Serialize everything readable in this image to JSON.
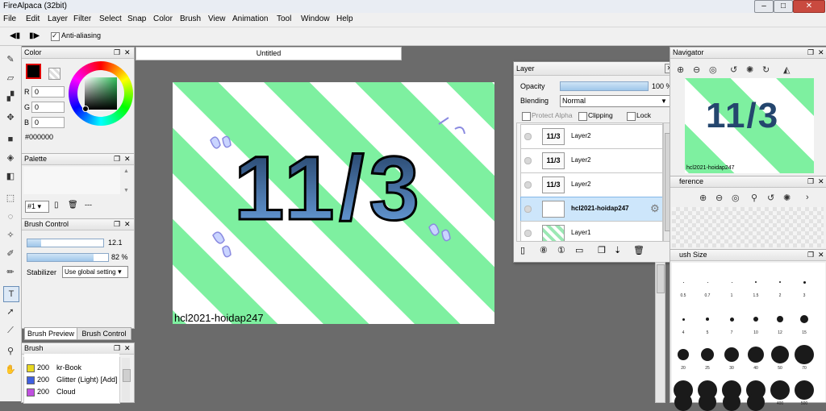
{
  "window": {
    "title": "FireAlpaca (32bit)"
  },
  "menu": [
    "File",
    "Edit",
    "Layer",
    "Filter",
    "Select",
    "Snap",
    "Color",
    "Brush",
    "View",
    "Animation",
    "Tool",
    "Window",
    "Help"
  ],
  "options": {
    "anti_aliasing": "Anti-aliasing"
  },
  "color_panel": {
    "title": "Color",
    "r_label": "R",
    "r": "0",
    "g_label": "G",
    "g": "0",
    "b_label": "B",
    "b": "0",
    "hex": "#000000"
  },
  "palette_panel": {
    "title": "Palette",
    "set": "#1",
    "more": "---"
  },
  "brush_control": {
    "title": "Brush Control",
    "size": "12.1",
    "size_fraction": 0.18,
    "opacity": "82 %",
    "opacity_fraction": 0.82,
    "stabilizer_label": "Stabilizer",
    "stabilizer_value": "Use global setting"
  },
  "tabs": {
    "preview": "Brush Preview",
    "control": "Brush Control"
  },
  "brush_panel": {
    "title": "Brush",
    "items": [
      {
        "size": "200",
        "name": "kr-Book",
        "color": "#e8d820"
      },
      {
        "size": "200",
        "name": "Glitter (Light) [Add]",
        "color": "#4060e0"
      },
      {
        "size": "200",
        "name": "Cloud",
        "color": "#c050e0"
      }
    ]
  },
  "document": {
    "tab": "Untitled",
    "watermark": "hcl2021-hoidap247",
    "drawing_text": "11/3"
  },
  "layer_panel": {
    "title": "Layer",
    "opacity_label": "Opacity",
    "opacity": "100 %",
    "opacity_fraction": 1.0,
    "blending_label": "Blending",
    "blending": "Normal",
    "protect_alpha": "Protect Alpha",
    "clipping": "Clipping",
    "lock": "Lock",
    "layers": [
      {
        "name": "Layer2",
        "thumb": "11/3",
        "selected": false
      },
      {
        "name": "Layer2",
        "thumb": "11/3",
        "selected": false
      },
      {
        "name": "Layer2",
        "thumb": "11/3",
        "selected": false
      },
      {
        "name": "hcl2021-hoidap247",
        "thumb": "",
        "selected": true
      },
      {
        "name": "Layer1",
        "thumb": "",
        "selected": false
      }
    ]
  },
  "navigator": {
    "title": "Navigator",
    "thumb_text": "11/3",
    "thumb_caption": "hcl2021-hoidap247"
  },
  "reference": {
    "title": "ference"
  },
  "brush_size": {
    "title": "ush Size",
    "rows": [
      [
        "0.5",
        "0.7",
        "1",
        "1.5",
        "2",
        "3"
      ],
      [
        "4",
        "5",
        "7",
        "10",
        "12",
        "15"
      ],
      [
        "20",
        "25",
        "30",
        "40",
        "50",
        "70"
      ],
      [
        "100",
        "150",
        "200",
        "300",
        "400",
        "500"
      ]
    ]
  },
  "colors": {
    "accent": "#3399ff",
    "stripe": "#7ef0a0",
    "selected_layer": "#cde6fb"
  }
}
